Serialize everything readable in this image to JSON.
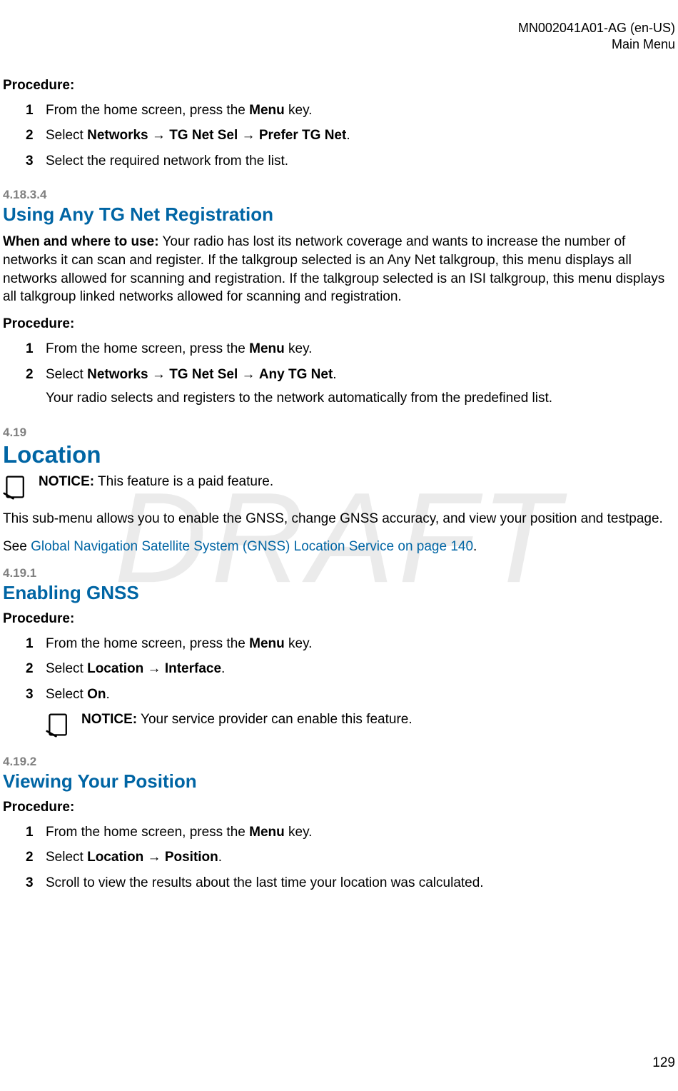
{
  "header": {
    "doc_id": "MN002041A01-AG (en-US)",
    "section": "Main Menu"
  },
  "watermark": "DRAFT",
  "proc_label": "Procedure:",
  "top_steps": {
    "s1": {
      "num": "1",
      "pre": "From the home screen, press the ",
      "bold": "Menu",
      "post": " key."
    },
    "s2": {
      "num": "2",
      "pre": "Select ",
      "b1": "Networks",
      "arrow1": " → ",
      "b2": "TG Net Sel",
      "arrow2": " → ",
      "b3": "Prefer TG Net",
      "post": "."
    },
    "s3": {
      "num": "3",
      "text": "Select the required network from the list."
    }
  },
  "sec_41834": {
    "num": "4.18.3.4",
    "title": "Using Any TG Net Registration",
    "para_lead": "When and where to use:",
    "para_rest": " Your radio has lost its network coverage and wants to increase the number of networks it can scan and register. If the talkgroup selected is an Any Net talkgroup, this menu displays all networks allowed for scanning and registration. If the talkgroup selected is an ISI talkgroup, this menu displays all talkgroup linked networks allowed for scanning and registration.",
    "steps": {
      "s1": {
        "num": "1",
        "pre": "From the home screen, press the ",
        "bold": "Menu",
        "post": " key."
      },
      "s2": {
        "num": "2",
        "pre": "Select ",
        "b1": "Networks",
        "arrow1": " → ",
        "b2": "TG Net Sel",
        "arrow2": " → ",
        "b3": "Any TG Net",
        "post": ".",
        "sub": "Your radio selects and registers to the network automatically from the predefined list."
      }
    }
  },
  "sec_419": {
    "num": "4.19",
    "title": "Location",
    "notice_label": "NOTICE:",
    "notice_text": " This feature is a paid feature.",
    "para1": "This sub-menu allows you to enable the GNSS, change GNSS accuracy, and view your position and testpage.",
    "see_pre": "See ",
    "see_link": "Global Navigation Satellite System (GNSS) Location Service on page 140",
    "see_post": "."
  },
  "sec_4191": {
    "num": "4.19.1",
    "title": "Enabling GNSS",
    "steps": {
      "s1": {
        "num": "1",
        "pre": "From the home screen, press the ",
        "bold": "Menu",
        "post": " key."
      },
      "s2": {
        "num": "2",
        "pre": "Select ",
        "b1": "Location",
        "arrow1": " → ",
        "b2": "Interface",
        "post": "."
      },
      "s3": {
        "num": "3",
        "pre": "Select ",
        "b1": "On",
        "post": "."
      }
    },
    "notice_label": "NOTICE:",
    "notice_text": " Your service provider can enable this feature."
  },
  "sec_4192": {
    "num": "4.19.2",
    "title": "Viewing Your Position",
    "steps": {
      "s1": {
        "num": "1",
        "pre": "From the home screen, press the ",
        "bold": "Menu",
        "post": " key."
      },
      "s2": {
        "num": "2",
        "pre": "Select ",
        "b1": "Location",
        "arrow1": " → ",
        "b2": "Position",
        "post": "."
      },
      "s3": {
        "num": "3",
        "text": "Scroll to view the results about the last time your location was calculated."
      }
    }
  },
  "page_number": "129"
}
